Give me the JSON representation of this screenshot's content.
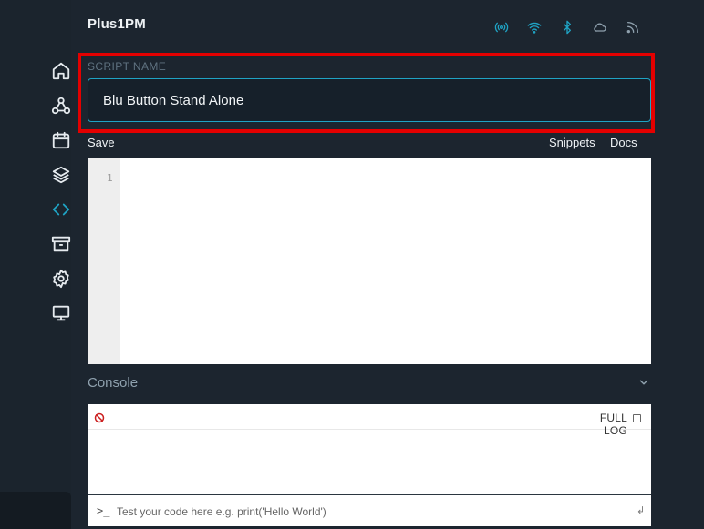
{
  "app": {
    "title": "Plus1PM"
  },
  "status_icons": [
    "radio-icon",
    "wifi-icon",
    "bluetooth-icon",
    "cloud-icon",
    "rss-icon"
  ],
  "sidebar": {
    "items": [
      {
        "icon": "home-icon",
        "active": false
      },
      {
        "icon": "webhook-icon",
        "active": false
      },
      {
        "icon": "calendar-icon",
        "active": false
      },
      {
        "icon": "layers-icon",
        "active": false
      },
      {
        "icon": "code-icon",
        "active": true
      },
      {
        "icon": "archive-icon",
        "active": false
      },
      {
        "icon": "gear-icon",
        "active": false
      },
      {
        "icon": "monitor-icon",
        "active": false
      }
    ]
  },
  "script": {
    "label": "SCRIPT NAME",
    "name_value": "Blu Button Stand Alone",
    "save_label": "Save",
    "snippets_label": "Snippets",
    "docs_label": "Docs"
  },
  "editor": {
    "line_numbers": [
      "1"
    ]
  },
  "console": {
    "title": "Console",
    "full_log_label": "FULL LOG",
    "full_log_checked": false,
    "input_prompt": ">_",
    "input_placeholder": "Test your code here e.g. print('Hello World')",
    "enter_symbol": "↲"
  },
  "colors": {
    "background": "#1c252f",
    "accent": "#1fa3c4",
    "highlight": "#e40000",
    "icon": "#e6ebef"
  }
}
